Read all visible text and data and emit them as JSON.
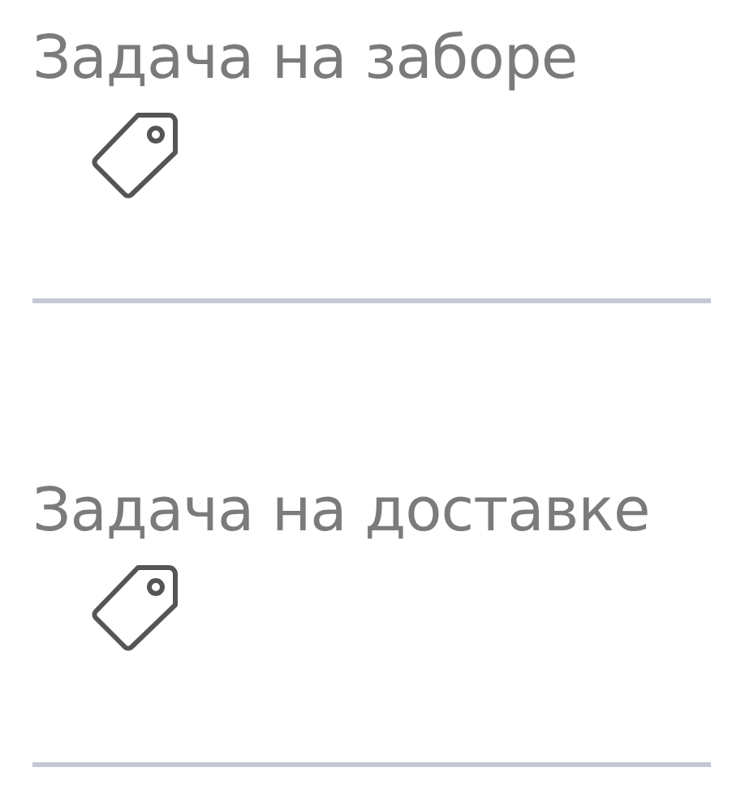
{
  "tasks": [
    {
      "title": "Задача на заборе"
    },
    {
      "title": "Задача на доставке"
    }
  ]
}
